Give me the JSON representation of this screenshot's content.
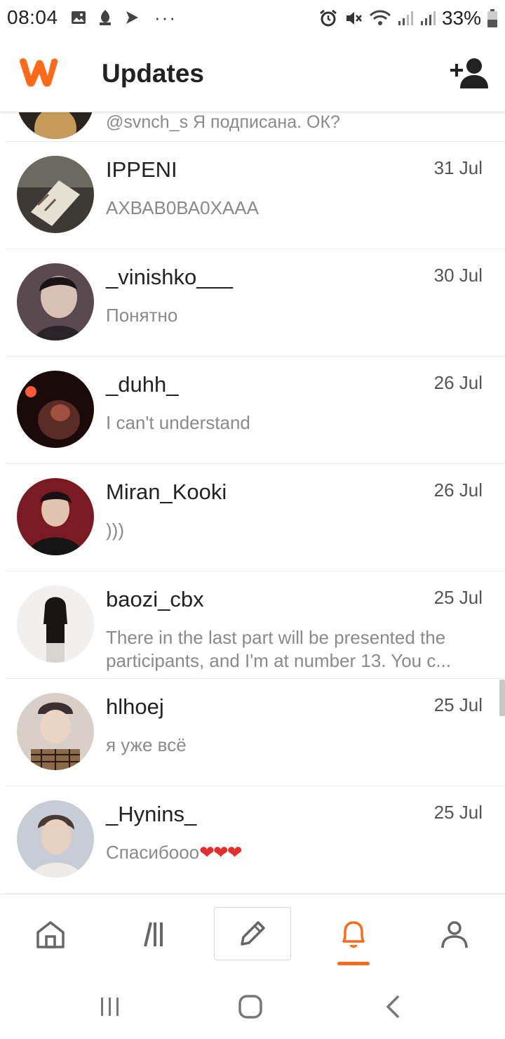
{
  "status_bar": {
    "time": "08:04",
    "battery": "33%",
    "left_icons": [
      "image-icon",
      "app-icon",
      "play-icon",
      "more-dots-icon"
    ],
    "right_icons": [
      "alarm-icon",
      "mute-icon",
      "wifi-icon",
      "signal-icon",
      "signal-icon",
      "battery-icon"
    ]
  },
  "header": {
    "title": "Updates",
    "logo_color": "#ff6a1a",
    "add_friend_icon": "add-user-icon"
  },
  "partial_item": {
    "message": "@svnch_s Я подписана. ОК?"
  },
  "items": [
    {
      "username": "IPPENI",
      "date": "31 Jul",
      "message": "АХВАВ0ВА0ХААА"
    },
    {
      "username": "_vinishko___",
      "date": "30 Jul",
      "message": "Понятно"
    },
    {
      "username": "_duhh_",
      "date": "26 Jul",
      "message": "I can't understand"
    },
    {
      "username": "Miran_Kooki",
      "date": "26 Jul",
      "message": ")))"
    },
    {
      "username": "baozi_cbx",
      "date": "25 Jul",
      "message_line1": "There in the last part will be presented the",
      "message_line2": "participants, and I'm at number 13. You c..."
    },
    {
      "username": "hlhoej",
      "date": "25 Jul",
      "message": "я уже всё"
    },
    {
      "username": "_Hynins_",
      "date": "25 Jul",
      "message": "Спасибооо",
      "message_emoji": "❤❤❤"
    }
  ],
  "bottom_nav": {
    "items": [
      "home-icon",
      "library-icon",
      "write-icon",
      "notifications-icon",
      "profile-icon"
    ],
    "active": "notifications-icon",
    "active_color": "#ff6a1a"
  },
  "system_nav": [
    "recents-icon",
    "home-circle-icon",
    "back-icon"
  ]
}
